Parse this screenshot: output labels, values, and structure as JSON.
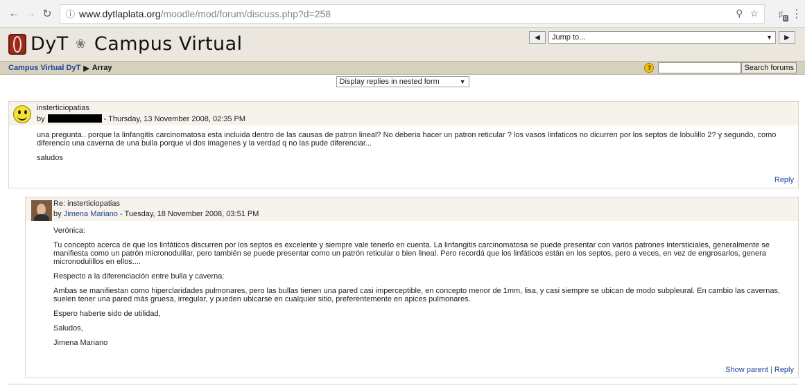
{
  "browser": {
    "url_host": "www.dytlaplata.org",
    "url_path": "/moodle/mod/forum/discuss.php?d=258",
    "ext_badge": "0"
  },
  "site": {
    "title_a": "DyT",
    "title_b": "Campus Virtual",
    "jump_placeholder": "Jump to..."
  },
  "breadcrumb": {
    "home": "Campus Virtual DyT",
    "separator": "▶",
    "current": "Array"
  },
  "search": {
    "button": "Search forums",
    "help": "?"
  },
  "display_mode": {
    "selected": "Display replies in nested form"
  },
  "posts": [
    {
      "subject": "insterticiopatias",
      "by": "by",
      "date": "- Thursday, 13 November 2008, 02:35 PM",
      "paragraphs": [
        "una pregunta.. porque la linfangitis carcinomatosa esta incluida dentro de las causas de patron lineal? No deberia hacer un patron reticular ? los vasos linfaticos no dicurren por los septos de lobulillo 2? y segundo, como diferencio una caverna de una bulla porque vi dos imagenes y la verdad q no las pude diferenciar...",
        "saludos"
      ],
      "reply": "Reply"
    },
    {
      "subject": "Re: insterticiopatias",
      "by": "by",
      "author": "Jimena Mariano",
      "date": "- Tuesday, 18 November 2008, 03:51 PM",
      "paragraphs": [
        "Verónica:",
        "Tu concepto acerca de que los linfáticos discurren por los septos es excelente y siempre vale tenerlo en cuenta. La linfangitis carcinomatosa se puede presentar con varios patrones intersticiales, generalmente se manifiesta como un patrón micronodulilar, pero también se puede presentar como un patrón reticular o bien lineal. Pero recordá que los linfáticos están en los septos, pero a veces, en vez de engrosarlos, genera micronodulillos en ellos....",
        "Respecto a la diferenciación entre bulla y caverna:",
        "Ambas se manifiestan como hiperclaridades pulmonares, pero las bullas tienen una pared casi imperceptible, en concepto menor de 1mm, lisa, y casi siempre se ubican de modo subpleural. En cambio las cavernas, suelen tener una pared más gruesa, irregular, y pueden ubicarse en cualquier sitio, preferentemente en apices pulmonares.",
        "Espero haberte sido de utilidad,",
        "Saludos,",
        "Jimena Mariano"
      ],
      "show_parent": "Show parent",
      "pipe": "|",
      "reply": "Reply"
    }
  ]
}
